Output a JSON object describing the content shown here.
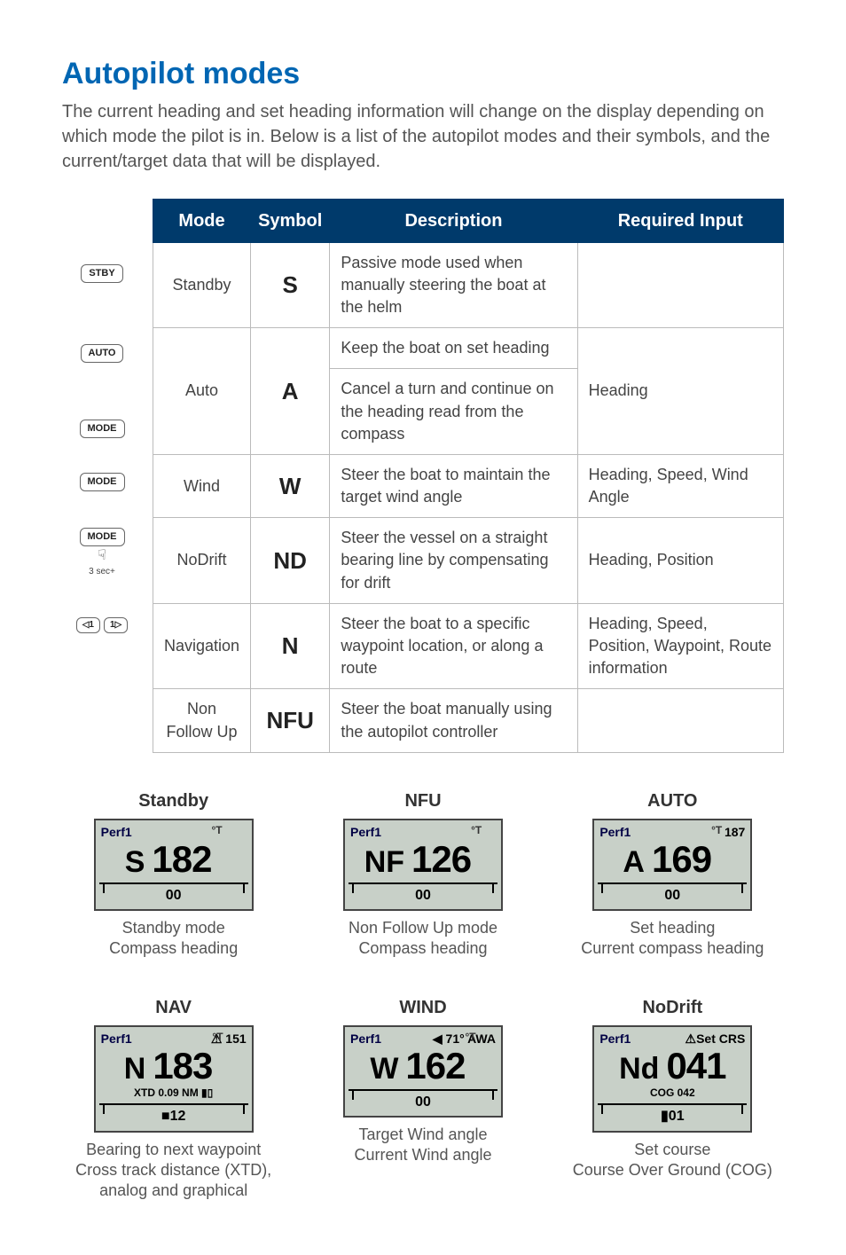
{
  "title": "Autopilot modes",
  "intro": "The current heading and set heading information will change on the display depending on which mode the pilot is in. Below is a list of the autopilot modes and their symbols, and the current/target data that will be displayed.",
  "table": {
    "headers": {
      "mode": "Mode",
      "symbol": "Symbol",
      "desc": "Description",
      "req": "Required Input"
    },
    "rows": [
      {
        "icon": "STBY",
        "mode": "Standby",
        "symbol": "S",
        "desc": [
          "Passive mode used when manually steering the boat at the helm"
        ],
        "req": ""
      },
      {
        "icon": "AUTO",
        "mode": "Auto",
        "symbol": "A",
        "desc": [
          "Keep the boat on set heading",
          "Cancel a turn and continue on the heading read from the compass"
        ],
        "req": "Heading"
      },
      {
        "icon": "MODE",
        "mode": "Wind",
        "symbol": "W",
        "desc": [
          "Steer the boat to maintain the target wind angle"
        ],
        "req": "Heading, Speed, Wind Angle"
      },
      {
        "icon": "MODE",
        "mode": "NoDrift",
        "symbol": "ND",
        "desc": [
          "Steer the vessel on a straight bearing line by compensating for drift"
        ],
        "req": "Heading, Position"
      },
      {
        "icon": "MODE_LONG",
        "mode": "Navigation",
        "symbol": "N",
        "desc": [
          "Steer the boat to a specific waypoint location, or along a route"
        ],
        "req": "Heading, Speed, Position, Waypoint, Route information"
      },
      {
        "icon": "NFU_KEYS",
        "mode": "Non Follow Up",
        "symbol": "NFU",
        "desc": [
          "Steer the boat manually using the autopilot controller"
        ],
        "req": ""
      }
    ],
    "mode_long_sub": "3\nsec+"
  },
  "displays": [
    {
      "title": "Standby",
      "perf": "Perf1",
      "perf_right": "",
      "sym": "S",
      "num": "182",
      "unit": "°T",
      "sub": "",
      "bottom": "00",
      "caption": "Standby mode\nCompass heading"
    },
    {
      "title": "NFU",
      "perf": "Perf1",
      "perf_right": "",
      "sym": "NF",
      "num": "126",
      "unit": "°T",
      "sub": "",
      "bottom": "00",
      "caption": "Non Follow Up mode\nCompass heading"
    },
    {
      "title": "AUTO",
      "perf": "Perf1",
      "perf_right": "187",
      "sym": "A",
      "num": "169",
      "unit": "°T",
      "sub": "",
      "bottom": "00",
      "caption": "Set heading\nCurrent compass heading"
    },
    {
      "title": "NAV",
      "perf": "Perf1",
      "perf_right": "⚠ 151",
      "sym": "N",
      "num": "183",
      "unit": "°T",
      "sub": "XTD 0.09 NM  ▮▯",
      "bottom": "■12",
      "caption": "Bearing to next waypoint\nCross track distance (XTD), analog and graphical"
    },
    {
      "title": "WIND",
      "perf": "Perf1",
      "perf_right": "◀ 71°  AWA",
      "sym": "W",
      "num": "162",
      "unit": "°T",
      "sub": "",
      "bottom": "00",
      "caption": "Target Wind angle\nCurrent Wind angle"
    },
    {
      "title": "NoDrift",
      "perf": "Perf1",
      "perf_right": "⚠Set CRS",
      "sym": "Nd",
      "num": "041",
      "unit": "",
      "sub": "COG  042",
      "bottom": "▮01",
      "caption": "Set course\nCourse Over Ground (COG)"
    }
  ],
  "icons": {
    "arrow_left": "◁",
    "arrow_right": "▷",
    "press": "⬇"
  }
}
